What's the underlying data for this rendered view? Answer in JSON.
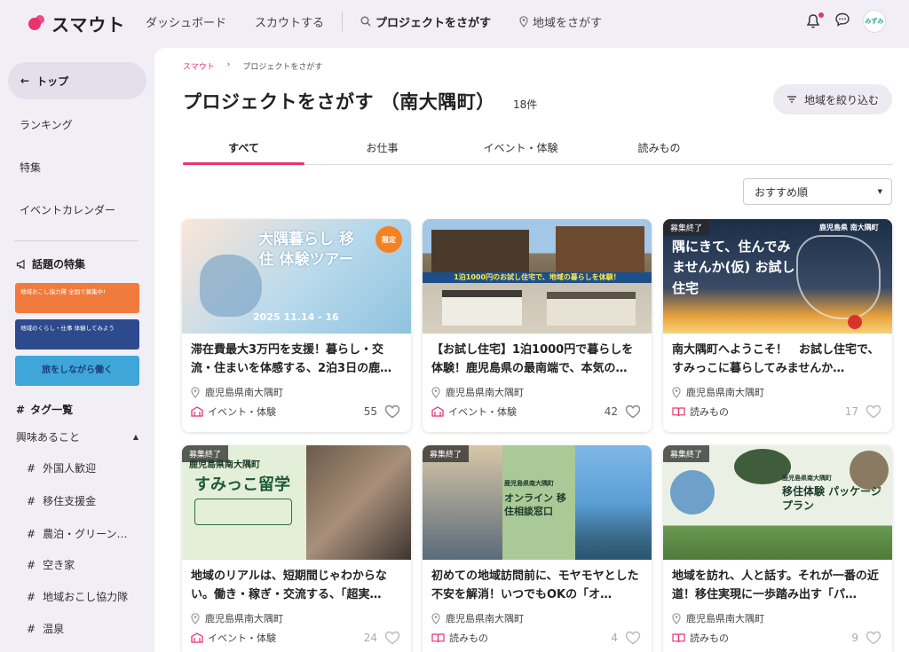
{
  "header": {
    "logo_text": "スマウト",
    "nav": [
      {
        "label": "ダッシュボード"
      },
      {
        "label": "スカウトする"
      },
      {
        "label": "プロジェクトをさがす"
      },
      {
        "label": "地域をさがす"
      }
    ],
    "avatar_text": "みずみ"
  },
  "sidebar": {
    "top_label": "トップ",
    "links": [
      "ランキング",
      "特集",
      "イベントカレンダー"
    ],
    "featured_heading": "話題の特集",
    "banners": [
      {
        "text": "地域おこし協力隊 全国で募集中!",
        "color": "#f07b3c"
      },
      {
        "text": "地域のくらし・仕事 体験してみよう",
        "color": "#2d4a8e"
      },
      {
        "text": "旅をしながら働く",
        "color": "#3fa6d9"
      }
    ],
    "tags_heading": "タグ一覧",
    "interest_label": "興味あること",
    "tags": [
      "外国人歓迎",
      "移住支援金",
      "農泊・グリーン…",
      "空き家",
      "地域おこし協力隊",
      "温泉"
    ]
  },
  "main": {
    "breadcrumb": {
      "home": "スマウト",
      "current": "プロジェクトをさがす"
    },
    "title": "プロジェクトをさがす （南大隅町）",
    "count": "18件",
    "filter_button": "地域を絞り込む",
    "tabs": [
      "すべて",
      "お仕事",
      "イベント・体験",
      "読みもの"
    ],
    "sort_value": "おすすめ順",
    "cards": [
      {
        "title": "滞在費最大3万円を支援！暮らし・交流・住まいを体感する、2泊3日の鹿…",
        "location": "鹿児島県南大隅町",
        "category": "イベント・体験",
        "likes": "55",
        "ended": "",
        "thumb_text": "大隅暮らし 移住 体験ツアー",
        "thumb_sub": "2025 11.14 - 16",
        "thumb_color": "#8fc3de"
      },
      {
        "title": "【お試し住宅】1泊1000円で暮らしを体験！鹿児島県の最南端で、本気の…",
        "location": "鹿児島県南大隅町",
        "category": "イベント・体験",
        "likes": "42",
        "ended": "",
        "thumb_text": "1泊1000円のお試し住宅で、地域の暮らしを体験！",
        "thumb_sub": "",
        "thumb_color": "#7a6a55"
      },
      {
        "title": "南大隅町へようこそ！　お試し住宅で、すみっこに暮らしてみませんか…",
        "location": "鹿児島県南大隅町",
        "category": "読みもの",
        "likes": "17",
        "ended": "募集終了",
        "thumb_text": "隅にきて、住んでみませんか(仮) お試し住宅",
        "thumb_sub": "鹿児島県 南大隅町",
        "thumb_color": "#1f3b57"
      },
      {
        "title": "地域のリアルは、短期間じゃわからない。働き・稼ぎ・交流する、「超実…",
        "location": "鹿児島県南大隅町",
        "category": "イベント・体験",
        "likes": "24",
        "ended": "募集終了",
        "thumb_text": "すみっこ留学",
        "thumb_sub": "鹿児島県南大隅町",
        "thumb_color": "#bcd8a6"
      },
      {
        "title": "初めての地域訪問前に、モヤモヤとした不安を解消！いつでもOKの「オ…",
        "location": "鹿児島県南大隅町",
        "category": "読みもの",
        "likes": "4",
        "ended": "募集終了",
        "thumb_text": "オンライン 移住相談窓口",
        "thumb_sub": "鹿児島県南大隅町",
        "thumb_color": "#9bbf85"
      },
      {
        "title": "地域を訪れ、人と話す。それが一番の近道！移住実現に一歩踏み出す「パ…",
        "location": "鹿児島県南大隅町",
        "category": "読みもの",
        "likes": "9",
        "ended": "募集終了",
        "thumb_text": "移住体験 パッケージプラン",
        "thumb_sub": "鹿児島県南大隅町",
        "thumb_color": "#4e7a3a"
      }
    ]
  },
  "colors": {
    "accent": "#e8336d",
    "bg": "#f1eef5"
  }
}
